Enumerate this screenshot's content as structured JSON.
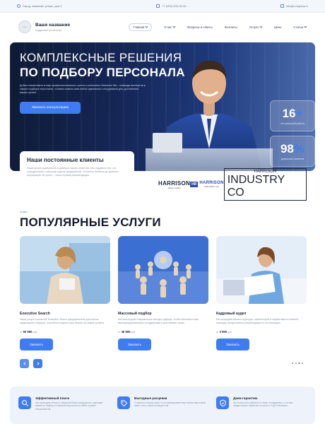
{
  "topbar": {
    "address": "Город, название улицы, дом 1",
    "phone": "+7 (000) 000-00-00",
    "email": "info@company.ru"
  },
  "header": {
    "logo_text": "logo",
    "brand_name": "Ваше название",
    "brand_sub": "Кадровое агентство",
    "nav": [
      "Главная",
      "О нас",
      "Вопросы и ответы",
      "Контакты",
      "Услуги",
      "Цены",
      "Статьи"
    ]
  },
  "hero": {
    "title_line1": "КОМПЛЕКСНЫЕ РЕШЕНИЯ",
    "title_line2": "ПО ПОДБОРУ ПЕРСОНАЛА",
    "description": "Добро пожаловать в мир профессионального роста и успешного бизнеса! Мы - команда экспертов в сфере подбора персонала, готовая помочь вам найти идеальных сотрудников для достижения ваших целей.",
    "cta": "Заказать консультацию",
    "stats": [
      {
        "value": "16",
        "suffix": "+",
        "label": "лет успешной работы"
      },
      {
        "value": "98",
        "suffix": "%",
        "label": "довольных клиентов"
      }
    ]
  },
  "clients": {
    "title": "Наши постоянные клиенты",
    "description": "Наши услуги доверяются в доверии наших клиентов. Мы гордимся тем, что сотрудничаем с широким кругом предприятий, от малого бизнеса до крупных корпораций. Их успех – наша лучшая рекомендация.",
    "logos": [
      {
        "big": "HARRISON",
        "small": "design studio"
      },
      {
        "mark": "HR",
        "big": "HARRISON",
        "small": "INDUSTRY CO"
      },
      {
        "big": "HARRISON",
        "small": "INDUSTRY CO"
      }
    ]
  },
  "services": {
    "tag": "Услуги",
    "title": "ПОПУЛЯРНЫЕ УСЛУГИ",
    "price_prefix": "от",
    "currency": "руб",
    "button": "Заказать",
    "items": [
      {
        "name": "Executive Search",
        "desc": "Наша услуга в качестве Executive Search предназначена для поиска выдающихся лидеров, способных поднять ваш бизнес на новый уровень.",
        "price": "50 990"
      },
      {
        "name": "Массовый подбор",
        "desc": "Мы используем современные методы подбора, чтобы обеспечить вас квалифицированными сотрудниками в кратчайшие сроки.",
        "price": "49 990"
      },
      {
        "name": "Кадровый аудит",
        "desc": "Мы проводим анализ структуры, компетенций и эффективности вашей команды, предоставляя рекомендации по оптимизации.",
        "price": "3 990"
      }
    ]
  },
  "benefits": [
    {
      "title": "Эффективный поиск",
      "desc": "Мы проводим отбор из обширной базы кандидатов, сокращая время на подбор и повышая вероятность найти лучших специалистов."
    },
    {
      "title": "Выгодные расценки",
      "desc": "Стоимость наших услуг по оптимизированному поиску персонала ниже, чем у наших конкурентов."
    },
    {
      "title": "Даем гарантию",
      "desc": "Мы полностью уверены в наших сотрудниках, и готовы предоставить гарантию на срок от 3 до 6 месяцев."
    }
  ],
  "colors": {
    "accent": "#3f7cf2",
    "hero_dark": "#0e1a36",
    "text": "#1c2333"
  }
}
